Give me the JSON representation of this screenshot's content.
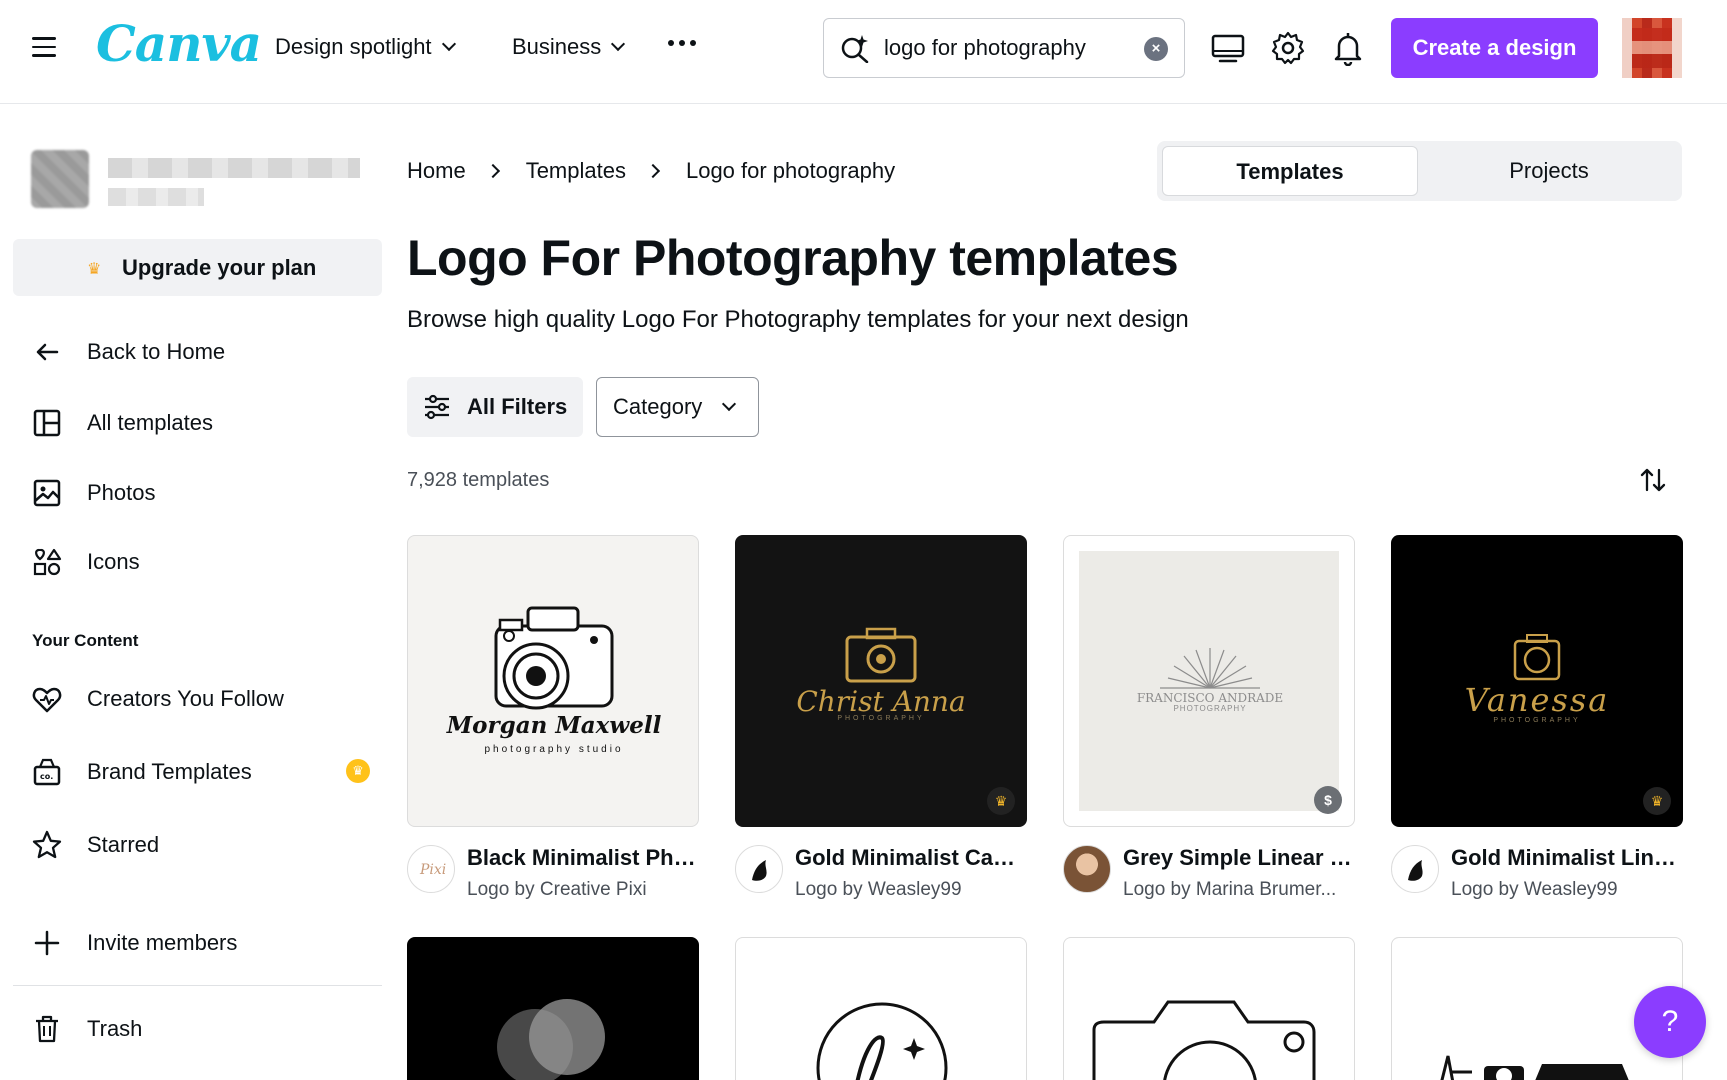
{
  "topbar": {
    "logo": "Canva",
    "nav": [
      {
        "label": "Design spotlight"
      },
      {
        "label": "Business"
      }
    ],
    "search": {
      "value": "logo for photography"
    },
    "create_label": "Create a design"
  },
  "sidebar": {
    "upgrade_label": "Upgrade your plan",
    "items": [
      {
        "label": "Back to Home"
      },
      {
        "label": "All templates"
      },
      {
        "label": "Photos"
      },
      {
        "label": "Icons"
      }
    ],
    "content_heading": "Your Content",
    "content_items": [
      {
        "label": "Creators You Follow"
      },
      {
        "label": "Brand Templates"
      },
      {
        "label": "Starred"
      }
    ],
    "invite_label": "Invite members",
    "trash_label": "Trash"
  },
  "breadcrumb": [
    "Home",
    "Templates",
    "Logo for photography"
  ],
  "segmented": {
    "active": "Templates",
    "other": "Projects"
  },
  "page": {
    "title": "Logo For Photography templates",
    "subtitle": "Browse high quality Logo For Photography templates for your next design",
    "filters_label": "All Filters",
    "category_label": "Category",
    "count": "7,928 templates"
  },
  "cards": [
    {
      "title": "Black Minimalist Pho...",
      "author": "Logo by Creative Pixi",
      "art_name": "Morgan Maxwell",
      "art_sub": "photography studio",
      "avatar_text": "Pixi"
    },
    {
      "title": "Gold Minimalist Cam...",
      "author": "Logo by Weasley99",
      "art_name": "Christ Anna",
      "art_sub": "PHOTOGRAPHY"
    },
    {
      "title": "Grey Simple Linear f...",
      "author": "Logo by Marina Brumer...",
      "art_name": "FRANCISCO ANDRADE",
      "art_sub": "PHOTOGRAPHY"
    },
    {
      "title": "Gold Minimalist Line...",
      "author": "Logo by Weasley99",
      "art_name": "Vanessa",
      "art_sub": "PHOTOGRAPHY"
    }
  ],
  "help_label": "?",
  "colors": {
    "brand": "#8b3dff",
    "logo": "#1bbfe0",
    "gold": "#c9a04a"
  }
}
